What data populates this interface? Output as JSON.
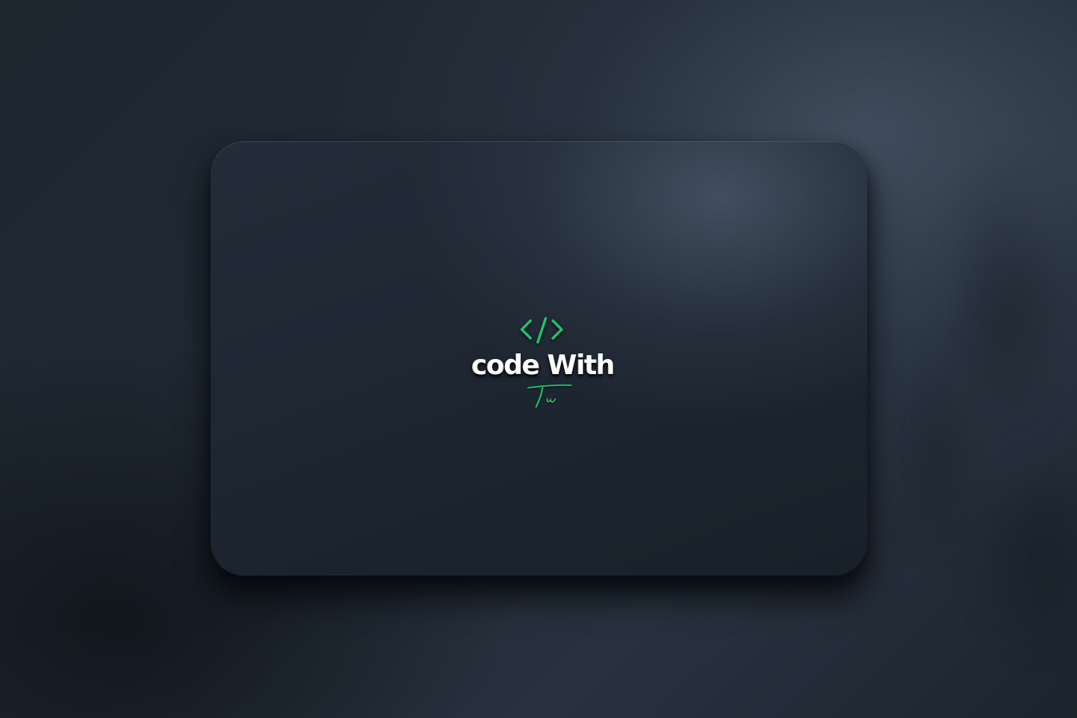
{
  "logo": {
    "brand_text": "code With",
    "signature_text": "Tw",
    "icon": "code-brackets-icon",
    "accent_color": "#1fc46b",
    "text_color": "#ffffff"
  },
  "background": {
    "base_color": "#1e2630",
    "card_color": "#1d2631"
  }
}
